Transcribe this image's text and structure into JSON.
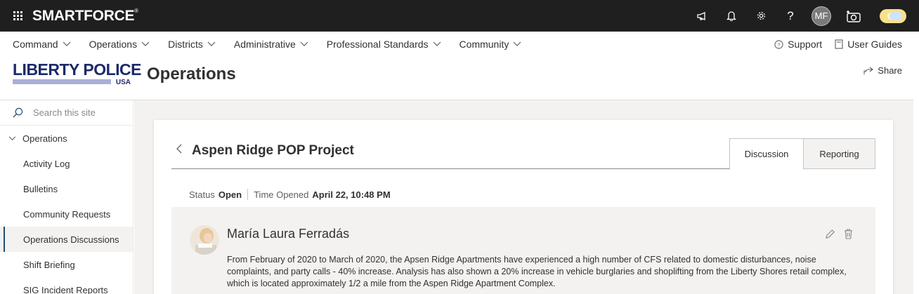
{
  "topbar": {
    "brand": "SMARTFORCE",
    "brand_mark": "®",
    "icons": [
      "megaphone-icon",
      "bell-icon",
      "gear-icon",
      "help-icon",
      "avatar",
      "camera-icon",
      "theme-toggle"
    ],
    "user_initials": "MF",
    "help_glyph": "?"
  },
  "nav": {
    "items": [
      "Command",
      "Operations",
      "Districts",
      "Administrative",
      "Professional Standards",
      "Community"
    ],
    "support_label": "Support",
    "guides_label": "User Guides"
  },
  "site": {
    "logo_text": "LIBERTY POLICE",
    "logo_sub": "USA",
    "title": "Operations",
    "share_label": "Share"
  },
  "leftnav": {
    "search_placeholder": "Search this site",
    "parent_label": "Operations",
    "items": [
      "Activity Log",
      "Bulletins",
      "Community Requests",
      "Operations Discussions",
      "Shift Briefing",
      "SIG Incident Reports"
    ],
    "active_index": 3
  },
  "page": {
    "title": "Aspen Ridge POP Project",
    "tabs": [
      "Discussion",
      "Reporting"
    ],
    "status_label": "Status",
    "status_value": "Open",
    "opened_label": "Time Opened",
    "opened_value": "April 22, 10:48 PM"
  },
  "post": {
    "author": "María Laura Ferradás",
    "text": "From February of 2020 to March of 2020, the Apsen Ridge Apartments have experienced a high number of CFS related to domestic disturbances, noise complaints, and party calls - 40% increase. Analysis has also shown a 20% increase in vehicle burglaries and shoplifting from the Liberty Shores retail complex, which is located approximately 1/2 a mile from the Aspen Ridge Apartment Complex."
  },
  "colors": {
    "topbar": "#1f1f1f",
    "logo_blue": "#1c2a6b",
    "active_bar": "#1f4e79",
    "content_bg": "#f3f2f1"
  }
}
